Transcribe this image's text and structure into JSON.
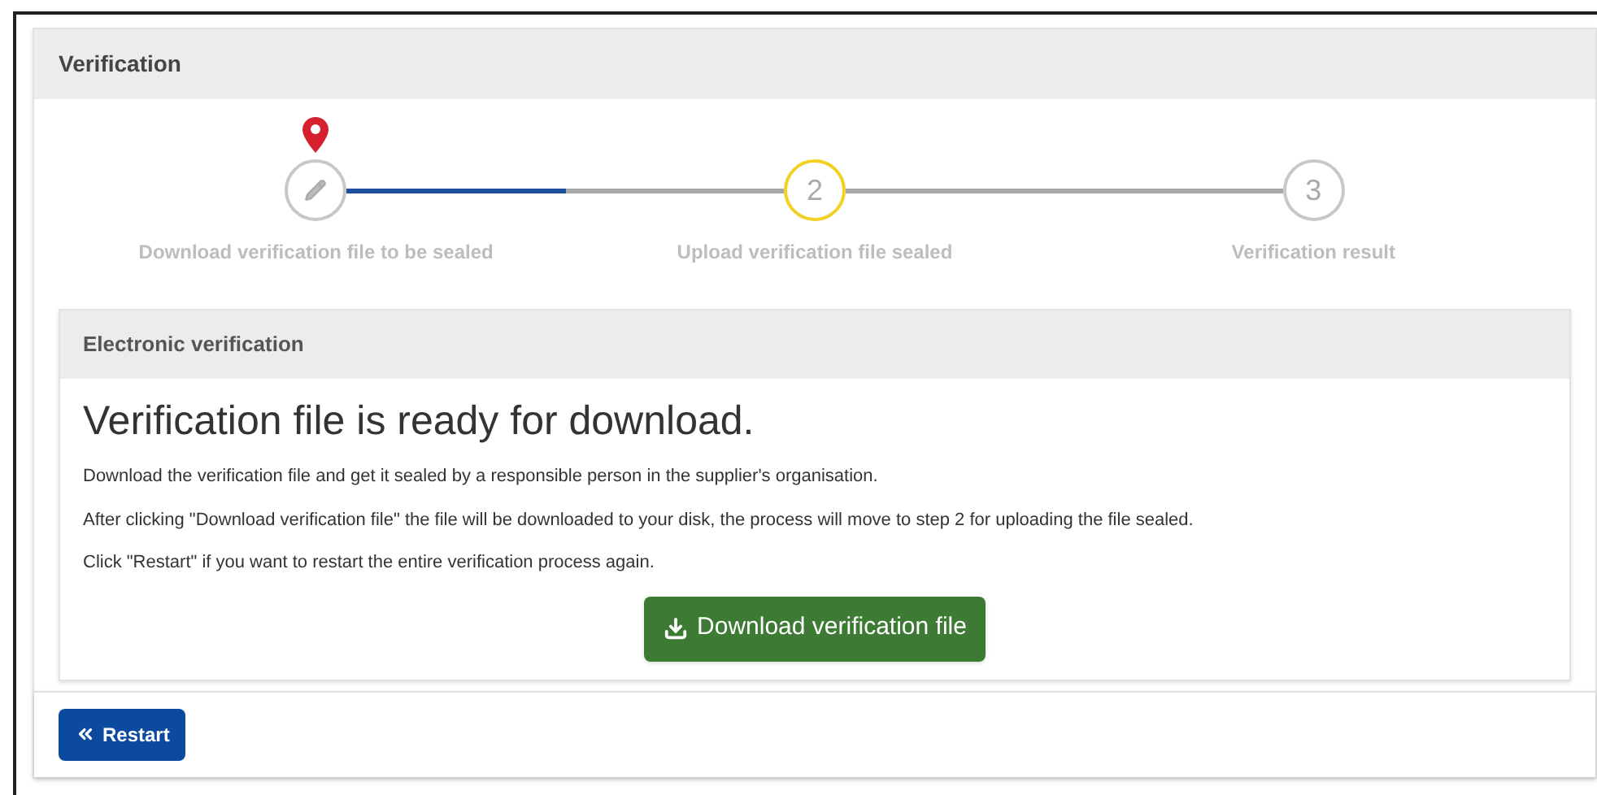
{
  "panel": {
    "title": "Verification"
  },
  "stepper": {
    "steps": [
      {
        "label": "Download verification file to be sealed",
        "current": true,
        "next": false
      },
      {
        "number": "2",
        "label": "Upload verification file sealed",
        "current": false,
        "next": true
      },
      {
        "number": "3",
        "label": "Verification result",
        "current": false,
        "next": false
      }
    ],
    "connectors": [
      {
        "level": 0.5
      }
    ]
  },
  "card": {
    "title": "Electronic verification",
    "heading": "Verification file is ready for download.",
    "paragraphs": [
      "Download the verification file and get it sealed by a responsible person in the supplier's organisation.",
      "After clicking \"Download verification file\" the file will be downloaded to your disk, the process will move to step 2 for uploading the file sealed.",
      "Click \"Restart\" if you want to restart the entire verification process again."
    ],
    "download_button": "Download verification file"
  },
  "restart_button": "Restart"
}
